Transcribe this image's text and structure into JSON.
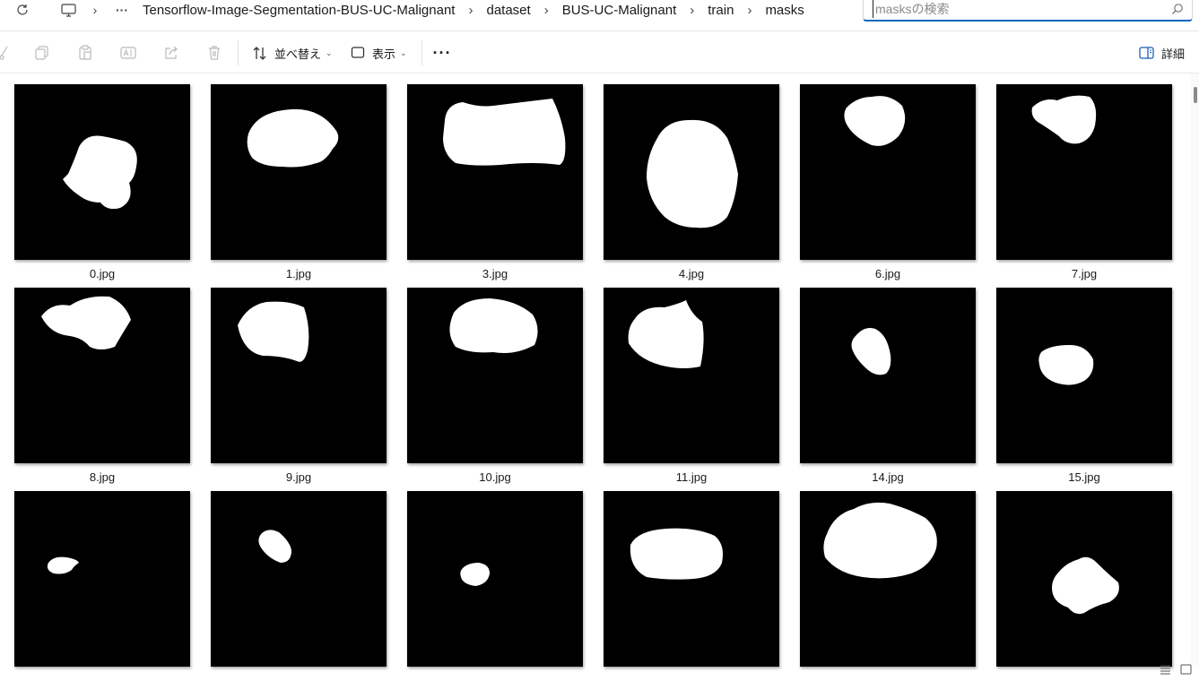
{
  "address_bar": {
    "refresh_icon": "refresh-icon",
    "pc_icon": "monitor-icon",
    "overflow": "···",
    "path": [
      "Tensorflow-Image-Segmentation-BUS-UC-Malignant",
      "dataset",
      "BUS-UC-Malignant",
      "train",
      "masks"
    ]
  },
  "search": {
    "placeholder": "masksの検索"
  },
  "toolbar": {
    "sort_label": "並べ替え",
    "view_label": "表示",
    "more_label": "···",
    "details_label": "詳細"
  },
  "files": [
    {
      "name": "0.jpg"
    },
    {
      "name": "1.jpg"
    },
    {
      "name": "3.jpg"
    },
    {
      "name": "4.jpg"
    },
    {
      "name": "6.jpg"
    },
    {
      "name": "7.jpg"
    },
    {
      "name": "8.jpg"
    },
    {
      "name": "9.jpg"
    },
    {
      "name": "10.jpg"
    },
    {
      "name": "11.jpg"
    },
    {
      "name": "14.jpg"
    },
    {
      "name": "15.jpg"
    },
    {
      "name": ""
    },
    {
      "name": ""
    },
    {
      "name": ""
    },
    {
      "name": ""
    },
    {
      "name": ""
    },
    {
      "name": ""
    }
  ],
  "colors": {
    "accent": "#0067c0",
    "mask_fg": "#ffffff",
    "mask_bg": "#000000"
  }
}
